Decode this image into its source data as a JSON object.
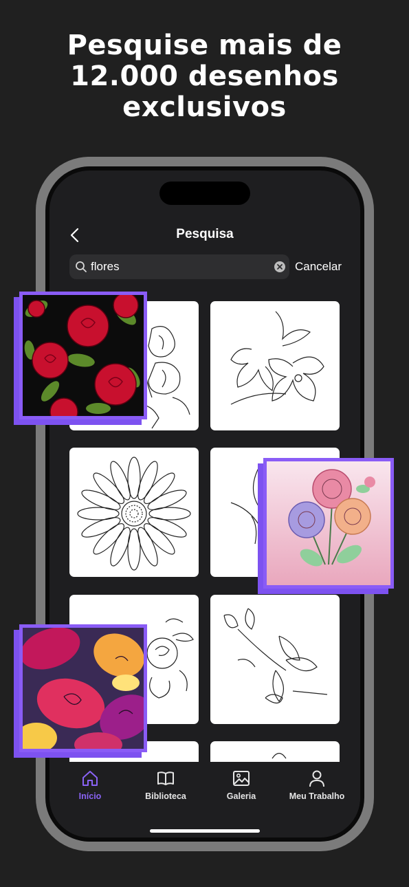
{
  "headline": {
    "line1": "Pesquise mais de",
    "line2": "12.000 desenhos",
    "line3": "exclusivos"
  },
  "nav": {
    "title": "Pesquisa",
    "back_icon": "chevron-left-icon"
  },
  "search": {
    "value": "flores",
    "cancel_label": "Cancelar",
    "icon": "search-icon",
    "clear_icon": "clear-icon"
  },
  "results": [
    {
      "name": "flowers-sketch-1"
    },
    {
      "name": "lilies-sketch"
    },
    {
      "name": "daisy-sketch"
    },
    {
      "name": "tulip-sketch"
    },
    {
      "name": "roses-sketch"
    },
    {
      "name": "magnolia-sketch"
    },
    {
      "name": "flower-sketch-7"
    },
    {
      "name": "flower-sketch-8"
    }
  ],
  "tabs": [
    {
      "label": "Início",
      "icon": "home-icon",
      "active": true
    },
    {
      "label": "Biblioteca",
      "icon": "book-icon",
      "active": false
    },
    {
      "label": "Galeria",
      "icon": "image-icon",
      "active": false
    },
    {
      "label": "Meu Trabalho",
      "icon": "user-icon",
      "active": false
    }
  ],
  "colors": {
    "background": "#202020",
    "accent": "#8a63f5",
    "phone_frame": "#7b7b7b",
    "screen": "#1e1e20"
  }
}
